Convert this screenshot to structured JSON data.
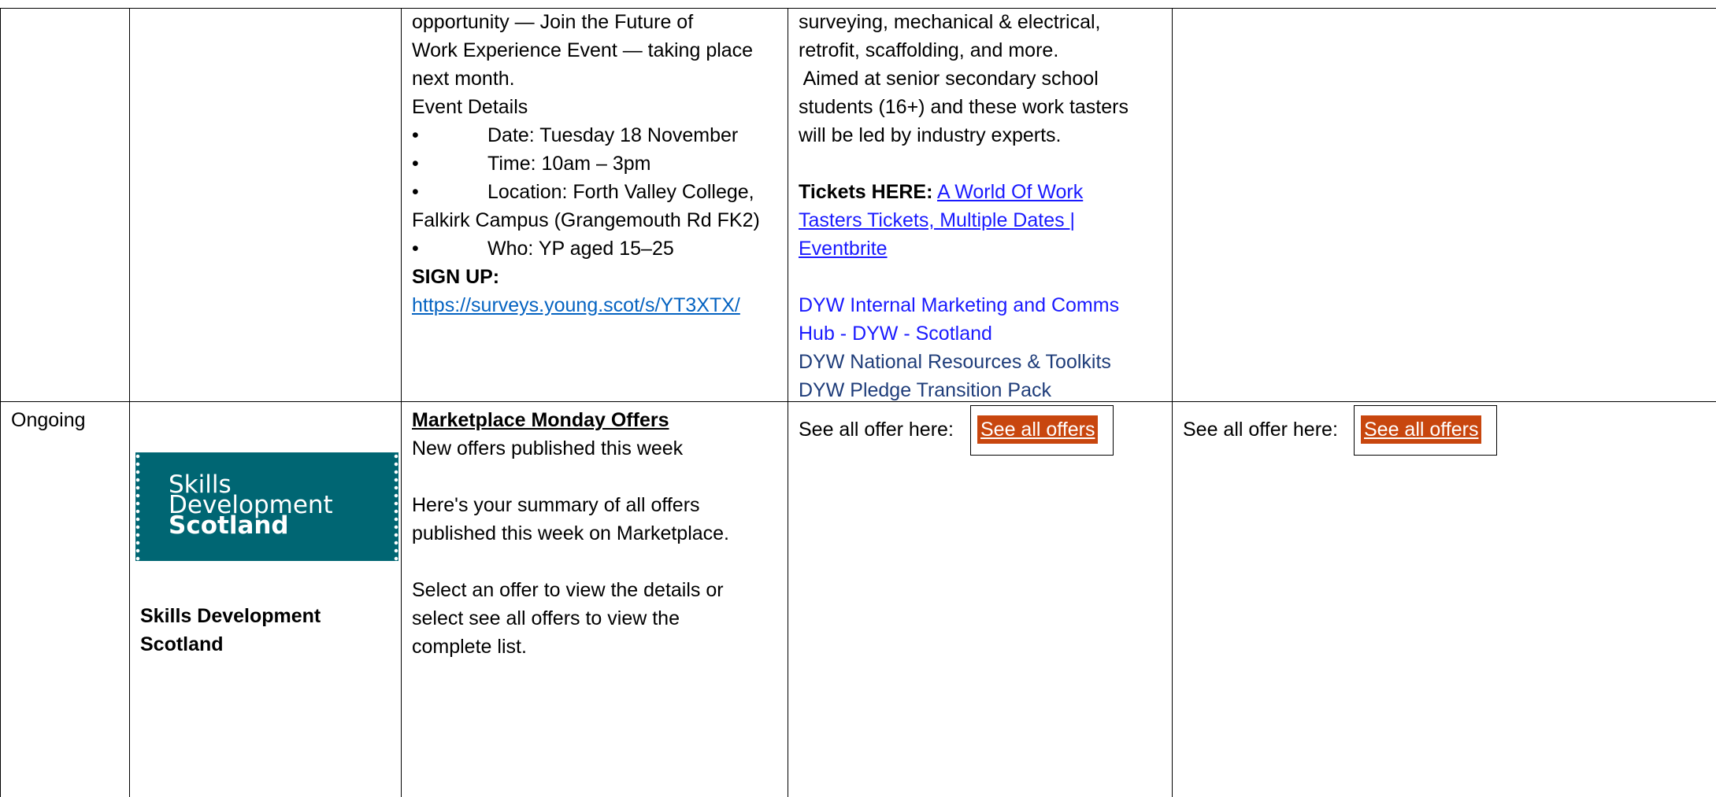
{
  "event_row": {
    "details": {
      "line1": "opportunity — Join the Future of",
      "line2": "Work Experience Event — taking place",
      "line3": "next month.",
      "heading": "Event Details",
      "bullet": "•",
      "date": "Date: Tuesday 18 November",
      "time": "Time: 10am – 3pm",
      "location_1": "Location: Forth Valley College,",
      "location_2": "Falkirk Campus (Grangemouth Rd FK2)",
      "who": "Who: YP aged 15–25",
      "signup_label": "SIGN UP:",
      "signup_link": "https://surveys.young.scot/s/YT3XTX/"
    },
    "tasters": {
      "line1": "surveying, mechanical & electrical,",
      "line2": "retrofit, scaffolding, and more.",
      "line3": " Aimed at senior secondary school",
      "line4": "students (16+) and these work tasters",
      "line5": "will be led by industry experts.",
      "tickets_label": "Tickets HERE:",
      "tickets_link_1": "A World Of Work",
      "tickets_link_2": "Tasters Tickets, Multiple Dates |",
      "tickets_link_3": "Eventbrite",
      "hub_link_1": "DYW Internal Marketing and Comms",
      "hub_link_2": "Hub - DYW - Scotland",
      "resources_link": "DYW National Resources & Toolkits",
      "pledge_link": "DYW Pledge Transition Pack"
    }
  },
  "ongoing_row": {
    "date": "Ongoing",
    "logo": {
      "line1": "Skills",
      "line2": "Development",
      "line3": "Scotland"
    },
    "org_name_1": "Skills Development",
    "org_name_2": "Scotland",
    "details": {
      "title": "Marketplace Monday Offers",
      "line1": "New offers published this week",
      "line2": "Here's your summary of all offers",
      "line3": "published this week on Marketplace.",
      "line4": "Select an offer to view the details or",
      "line5": "select see all offers to view the",
      "line6": "complete list."
    },
    "offer_col_a": {
      "label": "See all offer here:",
      "button": "See all offers"
    },
    "offer_col_b": {
      "label": "See all offer here:",
      "button": "See all offers"
    }
  },
  "colors": {
    "button_bg": "#c8460e",
    "logo_bg": "#006673",
    "link": "#0563c1"
  }
}
